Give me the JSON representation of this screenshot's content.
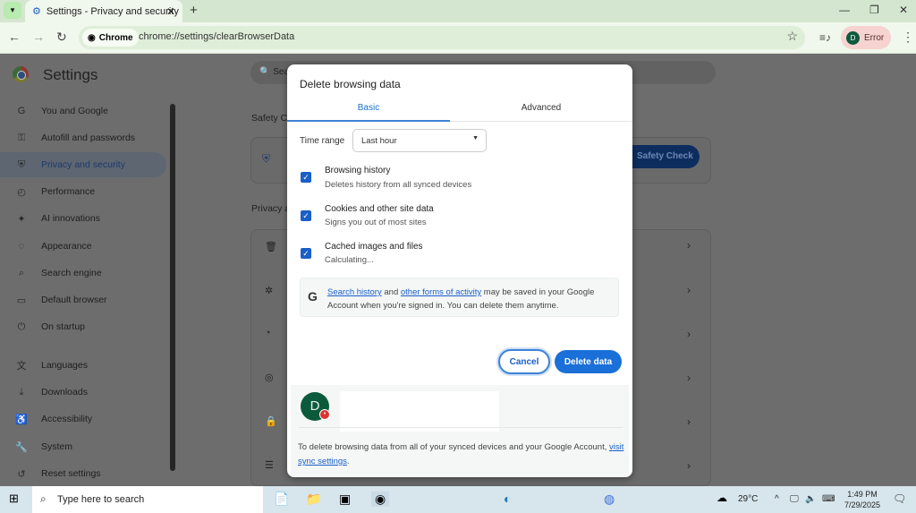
{
  "browser": {
    "tab_title": "Settings - Privacy and security",
    "chip": "Chrome",
    "url": "chrome://settings/clearBrowserData",
    "profile_status": "Error",
    "profile_initial": "D"
  },
  "settings": {
    "title": "Settings",
    "search_placeholder": "Sea",
    "sidebar": [
      {
        "label": "You and Google",
        "icon": "google-icon"
      },
      {
        "label": "Autofill and passwords",
        "icon": "key-icon"
      },
      {
        "label": "Privacy and security",
        "icon": "shield-icon",
        "selected": true
      },
      {
        "label": "Performance",
        "icon": "gauge-icon"
      },
      {
        "label": "AI innovations",
        "icon": "sparkle-icon"
      },
      {
        "label": "Appearance",
        "icon": "palette-icon"
      },
      {
        "label": "Search engine",
        "icon": "search-icon"
      },
      {
        "label": "Default browser",
        "icon": "browser-icon"
      },
      {
        "label": "On startup",
        "icon": "power-icon"
      },
      {
        "label": "Languages",
        "icon": "translate-icon"
      },
      {
        "label": "Downloads",
        "icon": "download-icon"
      },
      {
        "label": "Accessibility",
        "icon": "accessibility-icon"
      },
      {
        "label": "System",
        "icon": "wrench-icon"
      },
      {
        "label": "Reset settings",
        "icon": "reset-icon"
      }
    ],
    "section_safety": "Safety C",
    "safety_button": "Safety Check",
    "section_privacy": "Privacy a"
  },
  "dialog": {
    "title": "Delete browsing data",
    "tabs": [
      "Basic",
      "Advanced"
    ],
    "active_tab": "Basic",
    "time_range_label": "Time range",
    "time_range_value": "Last hour",
    "items": [
      {
        "title": "Browsing history",
        "subtitle": "Deletes history from all synced devices",
        "checked": true
      },
      {
        "title": "Cookies and other site data",
        "subtitle": "Signs you out of most sites",
        "checked": true
      },
      {
        "title": "Cached images and files",
        "subtitle": "Calculating...",
        "checked": true
      }
    ],
    "google_note": {
      "link1": "Search history",
      "and": " and ",
      "link2": "other forms of activity",
      "rest": " may be saved in your Google Account when you're signed in. You can delete them anytime."
    },
    "cancel": "Cancel",
    "delete": "Delete data",
    "account_initial": "D",
    "footer": {
      "text": "To delete browsing data from all of your synced devices and your Google Account, ",
      "link": "visit sync settings",
      "end": "."
    }
  },
  "taskbar": {
    "search_placeholder": "Type here to search",
    "weather": "29°C",
    "time": "1:49 PM",
    "date": "7/29/2025"
  },
  "colors": {
    "accent": "#1a6fd8",
    "avatar": "#0c5a3c",
    "error_chip": "#f6d3d0"
  }
}
